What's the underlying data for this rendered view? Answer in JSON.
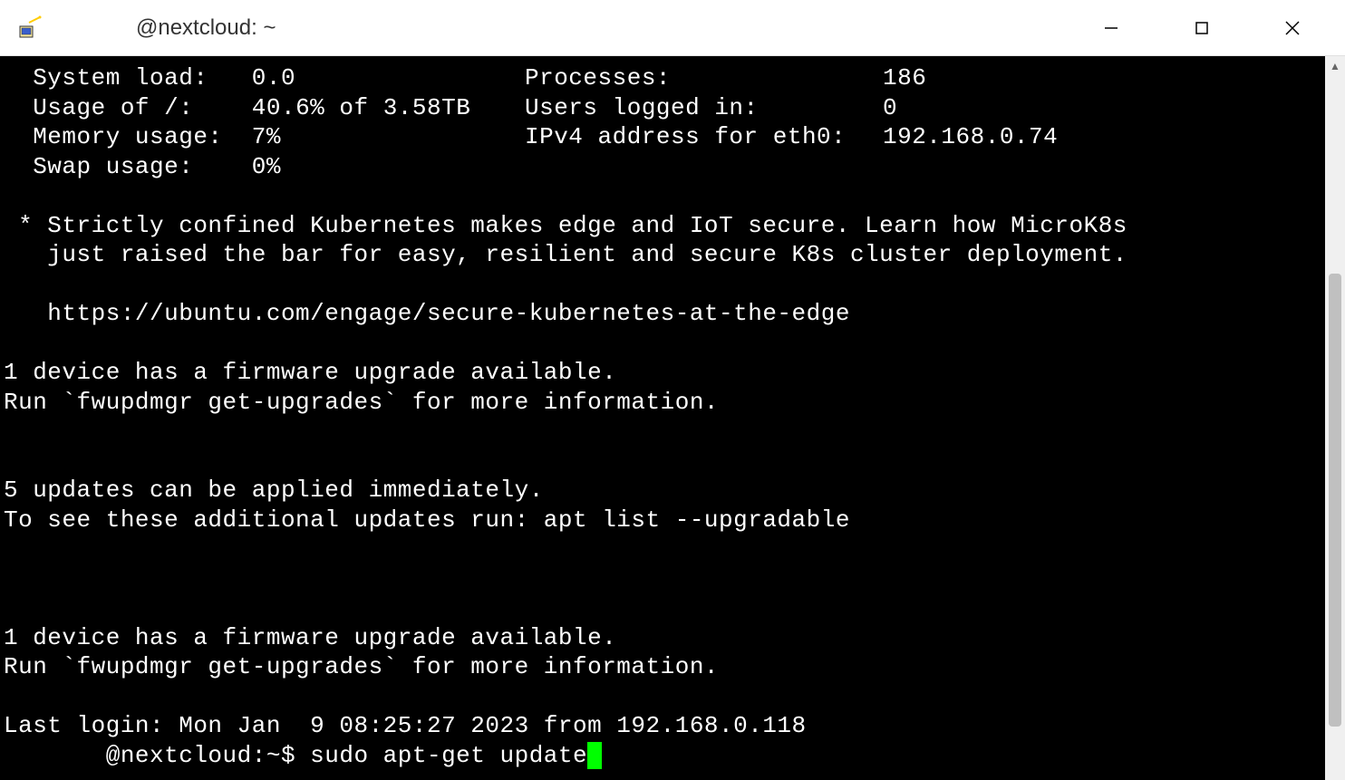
{
  "window": {
    "title": "@nextcloud: ~"
  },
  "stats": {
    "system_load_label": "  System load:",
    "system_load_value": "0.0",
    "processes_label": "Processes:",
    "processes_value": "186",
    "usage_label": "  Usage of /:",
    "usage_value": "40.6% of 3.58TB",
    "users_label": "Users logged in:",
    "users_value": "0",
    "memory_label": "  Memory usage:",
    "memory_value": "7%",
    "ipv4_label": "IPv4 address for eth0:",
    "ipv4_value": "192.168.0.74",
    "swap_label": "  Swap usage:",
    "swap_value": "0%"
  },
  "motd": {
    "k8s_line1": " * Strictly confined Kubernetes makes edge and IoT secure. Learn how MicroK8s",
    "k8s_line2": "   just raised the bar for easy, resilient and secure K8s cluster deployment.",
    "k8s_url": "   https://ubuntu.com/engage/secure-kubernetes-at-the-edge",
    "fw1_line1": "1 device has a firmware upgrade available.",
    "fw1_line2": "Run `fwupdmgr get-upgrades` for more information.",
    "updates_line1": "5 updates can be applied immediately.",
    "updates_line2": "To see these additional updates run: apt list --upgradable",
    "fw2_line1": "1 device has a firmware upgrade available.",
    "fw2_line2": "Run `fwupdmgr get-upgrades` for more information.",
    "last_login": "Last login: Mon Jan  9 08:25:27 2023 from 192.168.0.118"
  },
  "prompt": {
    "ps1": "       @nextcloud:~$ ",
    "command": "sudo apt-get update"
  }
}
